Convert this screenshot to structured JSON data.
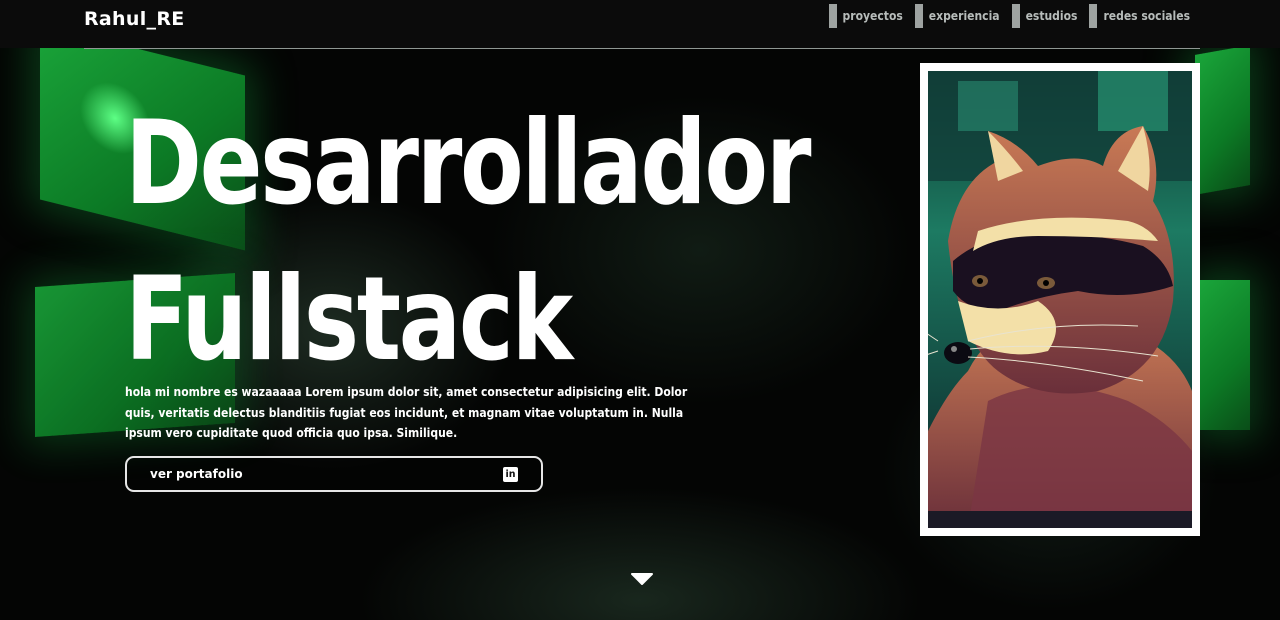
{
  "header": {
    "logo": "Rahul_RE",
    "nav": [
      "proyectos",
      "experiencia",
      "estudios",
      "redes sociales"
    ]
  },
  "hero": {
    "title_line1": "Desarrollador",
    "title_line2": "Fullstack",
    "intro": "hola mi nombre es wazaaaaa Lorem ipsum dolor sit, amet consectetur adipisicing elit. Dolor quis, veritatis delectus blanditiis fugiat eos incidunt, et magnam vitae voluptatum in. Nulla ipsum vero cupiditate quod officia quo ipsa. Similique.",
    "cta_label": "ver portafolio",
    "cta_icon": "linkedin-icon"
  },
  "colors": {
    "background": "#040504",
    "accent_green": "#1aa53a",
    "text": "#ffffff",
    "nav_text": "#b7bcba"
  }
}
